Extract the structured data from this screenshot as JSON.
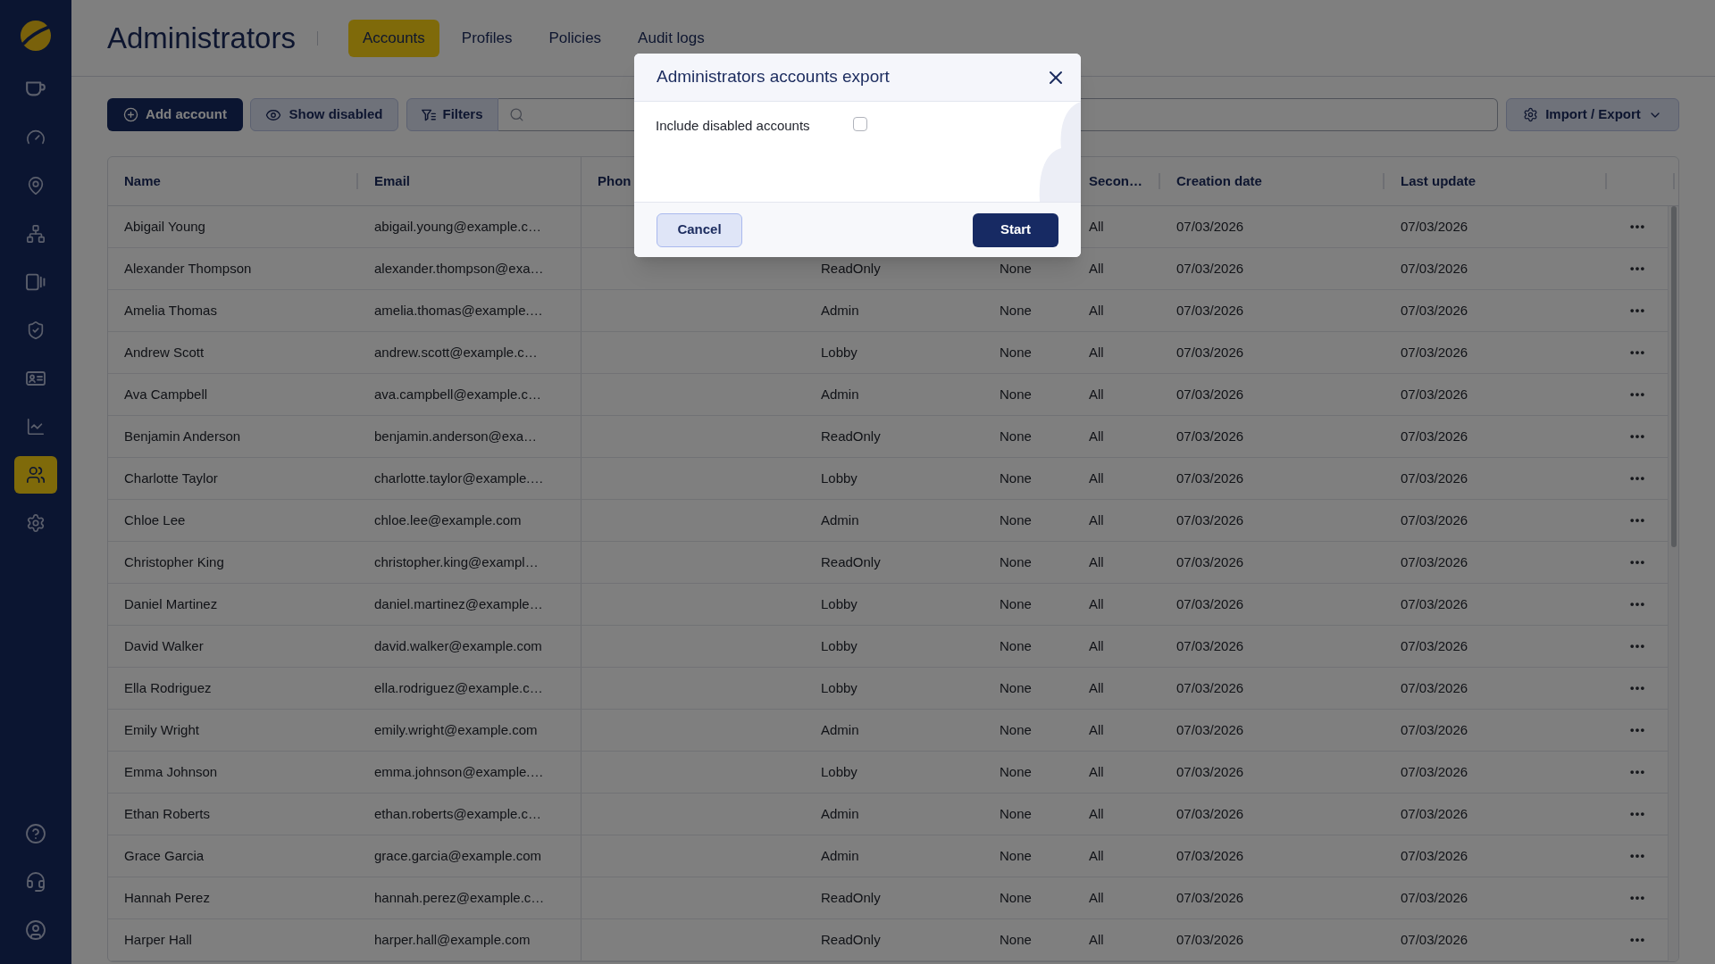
{
  "sidebar": {
    "items": [
      {
        "selected": false
      },
      {
        "selected": false
      },
      {
        "selected": false
      },
      {
        "selected": false
      },
      {
        "selected": false
      },
      {
        "selected": false
      },
      {
        "selected": false
      },
      {
        "selected": false
      },
      {
        "selected": true
      },
      {
        "selected": false
      }
    ]
  },
  "header": {
    "title": "Administrators",
    "tabs": [
      {
        "label": "Accounts",
        "selected": true
      },
      {
        "label": "Profiles",
        "selected": false
      },
      {
        "label": "Policies",
        "selected": false
      },
      {
        "label": "Audit logs",
        "selected": false
      }
    ]
  },
  "toolbar": {
    "add_button": "Add account",
    "show_disabled_button": "Show disabled",
    "filters_button": "Filters",
    "import_export_button": "Import / Export"
  },
  "table": {
    "header": {
      "name": "Name",
      "email": "Email",
      "column_3": "Phon",
      "column_6": "Secon…",
      "creation_date": "Creation date",
      "last_update": "Last update"
    },
    "rows": [
      {
        "name": "Abigail Young",
        "email": "abigail.young@example.c…",
        "column_6": "All",
        "creation_date": "07/03/2026",
        "last_update": "07/03/2026"
      },
      {
        "name": "Alexander Thompson",
        "email": "alexander.thompson@exa…",
        "column_4": "ReadOnly",
        "column_5": "None",
        "column_6": "All",
        "creation_date": "07/03/2026",
        "last_update": "07/03/2026"
      },
      {
        "name": "Amelia Thomas",
        "email": "amelia.thomas@example.…",
        "column_4": "Admin",
        "column_5": "None",
        "column_6": "All",
        "creation_date": "07/03/2026",
        "last_update": "07/03/2026"
      },
      {
        "name": "Andrew Scott",
        "email": "andrew.scott@example.c…",
        "column_4": "Lobby",
        "column_5": "None",
        "column_6": "All",
        "creation_date": "07/03/2026",
        "last_update": "07/03/2026"
      },
      {
        "name": "Ava Campbell",
        "email": "ava.campbell@example.c…",
        "column_4": "Admin",
        "column_5": "None",
        "column_6": "All",
        "creation_date": "07/03/2026",
        "last_update": "07/03/2026"
      },
      {
        "name": "Benjamin Anderson",
        "email": "benjamin.anderson@exa…",
        "column_4": "ReadOnly",
        "column_5": "None",
        "column_6": "All",
        "creation_date": "07/03/2026",
        "last_update": "07/03/2026"
      },
      {
        "name": "Charlotte Taylor",
        "email": "charlotte.taylor@example.…",
        "column_4": "Lobby",
        "column_5": "None",
        "column_6": "All",
        "creation_date": "07/03/2026",
        "last_update": "07/03/2026"
      },
      {
        "name": "Chloe Lee",
        "email": "chloe.lee@example.com",
        "column_4": "Admin",
        "column_5": "None",
        "column_6": "All",
        "creation_date": "07/03/2026",
        "last_update": "07/03/2026"
      },
      {
        "name": "Christopher King",
        "email": "christopher.king@exampl…",
        "column_4": "ReadOnly",
        "column_5": "None",
        "column_6": "All",
        "creation_date": "07/03/2026",
        "last_update": "07/03/2026"
      },
      {
        "name": "Daniel Martinez",
        "email": "daniel.martinez@example…",
        "column_4": "Lobby",
        "column_5": "None",
        "column_6": "All",
        "creation_date": "07/03/2026",
        "last_update": "07/03/2026"
      },
      {
        "name": "David Walker",
        "email": "david.walker@example.com",
        "column_4": "Lobby",
        "column_5": "None",
        "column_6": "All",
        "creation_date": "07/03/2026",
        "last_update": "07/03/2026"
      },
      {
        "name": "Ella Rodriguez",
        "email": "ella.rodriguez@example.c…",
        "column_4": "Lobby",
        "column_5": "None",
        "column_6": "All",
        "creation_date": "07/03/2026",
        "last_update": "07/03/2026"
      },
      {
        "name": "Emily Wright",
        "email": "emily.wright@example.com",
        "column_4": "Admin",
        "column_5": "None",
        "column_6": "All",
        "creation_date": "07/03/2026",
        "last_update": "07/03/2026"
      },
      {
        "name": "Emma Johnson",
        "email": "emma.johnson@example.…",
        "column_4": "Lobby",
        "column_5": "None",
        "column_6": "All",
        "creation_date": "07/03/2026",
        "last_update": "07/03/2026"
      },
      {
        "name": "Ethan Roberts",
        "email": "ethan.roberts@example.c…",
        "column_4": "Admin",
        "column_5": "None",
        "column_6": "All",
        "creation_date": "07/03/2026",
        "last_update": "07/03/2026"
      },
      {
        "name": "Grace Garcia",
        "email": "grace.garcia@example.com",
        "column_4": "Admin",
        "column_5": "None",
        "column_6": "All",
        "creation_date": "07/03/2026",
        "last_update": "07/03/2026"
      },
      {
        "name": "Hannah Perez",
        "email": "hannah.perez@example.c…",
        "column_4": "ReadOnly",
        "column_5": "None",
        "column_6": "All",
        "creation_date": "07/03/2026",
        "last_update": "07/03/2026"
      },
      {
        "name": "Harper Hall",
        "email": "harper.hall@example.com",
        "column_4": "ReadOnly",
        "column_5": "None",
        "column_6": "All",
        "creation_date": "07/03/2026",
        "last_update": "07/03/2026"
      }
    ]
  },
  "dialog": {
    "title": "Administrators accounts export",
    "option": {
      "label": "Include disabled accounts",
      "checked": false
    },
    "cancel_button": "Cancel",
    "start_button": "Start"
  }
}
